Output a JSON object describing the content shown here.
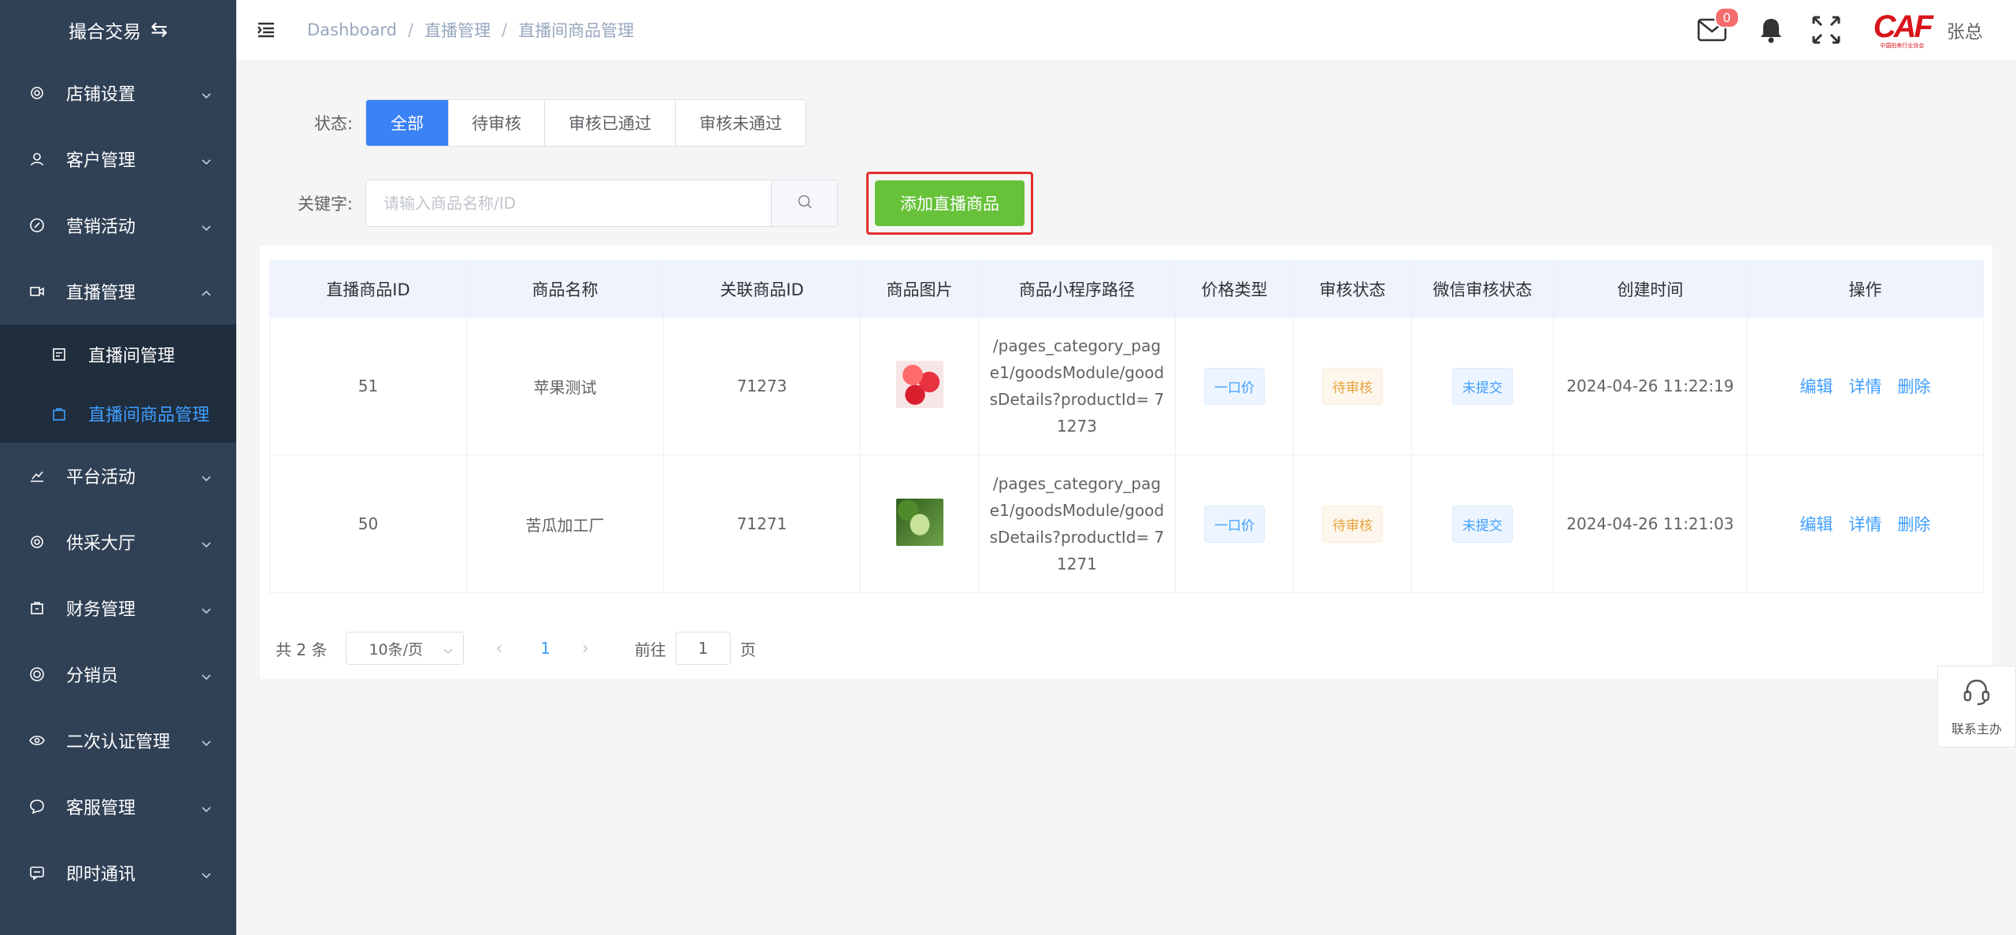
{
  "brand": {
    "title": "撮合交易"
  },
  "sidebar": {
    "items": [
      {
        "label": "店铺设置",
        "icon": "gear-icon"
      },
      {
        "label": "客户管理",
        "icon": "user-icon"
      },
      {
        "label": "营销活动",
        "icon": "compass-icon"
      },
      {
        "label": "直播管理",
        "icon": "video-camera-icon",
        "expanded": true,
        "children": [
          {
            "label": "直播间管理",
            "icon": "monitor-icon"
          },
          {
            "label": "直播间商品管理",
            "icon": "shopping-bag-icon",
            "active": true
          }
        ]
      },
      {
        "label": "平台活动",
        "icon": "chart-icon"
      },
      {
        "label": "供采大厅",
        "icon": "gear-icon"
      },
      {
        "label": "财务管理",
        "icon": "wallet-icon"
      },
      {
        "label": "分销员",
        "icon": "globe-icon"
      },
      {
        "label": "二次认证管理",
        "icon": "eye-icon"
      },
      {
        "label": "客服管理",
        "icon": "chat-bubble-icon"
      },
      {
        "label": "即时通讯",
        "icon": "message-icon"
      }
    ]
  },
  "header": {
    "breadcrumb": [
      "Dashboard",
      "直播管理",
      "直播间商品管理"
    ],
    "mail_badge": "0",
    "logo_text": "CAF",
    "logo_sub": "中国拍卖行业协会",
    "username": "张总"
  },
  "filters": {
    "status_label": "状态:",
    "status_options": [
      "全部",
      "待审核",
      "审核已通过",
      "审核未通过"
    ],
    "keyword_label": "关键字:",
    "keyword_placeholder": "请输入商品名称/ID",
    "keyword_value": "",
    "add_button": "添加直播商品"
  },
  "table": {
    "columns": [
      "直播商品ID",
      "商品名称",
      "关联商品ID",
      "商品图片",
      "商品小程序路径",
      "价格类型",
      "审核状态",
      "微信审核状态",
      "创建时间",
      "操作"
    ],
    "rows": [
      {
        "id": "51",
        "name": "苹果测试",
        "goods_id": "71273",
        "image": "red-apples",
        "path": "/pages_category_page1/goodsModule/goodsDetails?productId= 71273",
        "price_type": "一口价",
        "audit": "待审核",
        "wx_audit": "未提交",
        "created": "2024-04-26 11:22:19",
        "ops": [
          "编辑",
          "详情",
          "删除"
        ]
      },
      {
        "id": "50",
        "name": "苦瓜加工厂",
        "goods_id": "71271",
        "image": "bitter-melon",
        "path": "/pages_category_page1/goodsModule/goodsDetails?productId= 71271",
        "price_type": "一口价",
        "audit": "待审核",
        "wx_audit": "未提交",
        "created": "2024-04-26 11:21:03",
        "ops": [
          "编辑",
          "详情",
          "删除"
        ]
      }
    ]
  },
  "pagination": {
    "total_text": "共 2 条",
    "page_size": "10条/页",
    "current_page": "1",
    "goto_label": "前往",
    "goto_value": "1",
    "page_suffix": "页"
  },
  "contact": {
    "label": "联系主办"
  },
  "colors": {
    "sidebar_bg": "#304156",
    "primary": "#3b82f6",
    "success": "#67c23a",
    "active_link": "#409eff",
    "highlight_border": "#e52d2d"
  }
}
